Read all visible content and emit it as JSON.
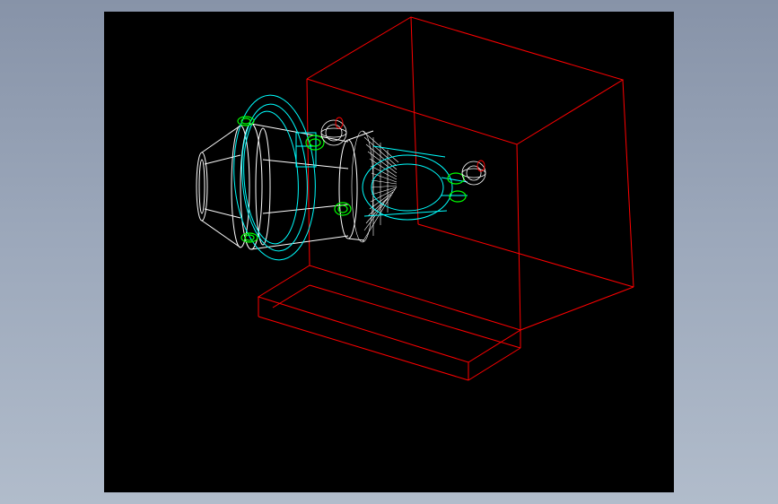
{
  "viewport": {
    "background": "#000000"
  },
  "colors": {
    "page_background": "#9aa6b8",
    "frame_lines": "#ff0000",
    "drum_lines": "#ffffff",
    "ring_lines": "#00ffff",
    "fitting_lines": "#00ff00",
    "bearing_detail": "#ff0000"
  },
  "model": {
    "icon": "wireframe-cad-model-icon"
  }
}
